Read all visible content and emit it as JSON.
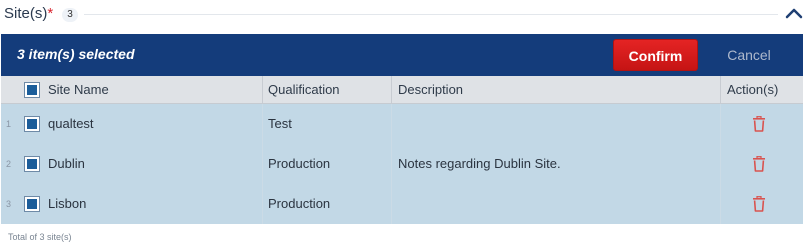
{
  "section": {
    "title": "Site(s)",
    "required_mark": "*",
    "count": "3"
  },
  "selection_bar": {
    "text": "3 item(s) selected",
    "confirm_label": "Confirm",
    "cancel_label": "Cancel"
  },
  "table": {
    "columns": {
      "site_name": "Site Name",
      "qualification": "Qualification",
      "description": "Description",
      "actions": "Action(s)"
    },
    "rows": [
      {
        "num": "1",
        "site_name": "qualtest",
        "qualification": "Test",
        "description": ""
      },
      {
        "num": "2",
        "site_name": "Dublin",
        "qualification": "Production",
        "description": "Notes regarding Dublin Site."
      },
      {
        "num": "3",
        "site_name": "Lisbon",
        "qualification": "Production",
        "description": ""
      }
    ]
  },
  "footer": {
    "total_text": "Total of 3 site(s)"
  },
  "colors": {
    "header_bar": "#143c7b",
    "confirm": "#d81e1e",
    "row_selected": "#c2d8e6",
    "delete_icon": "#d9534f"
  }
}
